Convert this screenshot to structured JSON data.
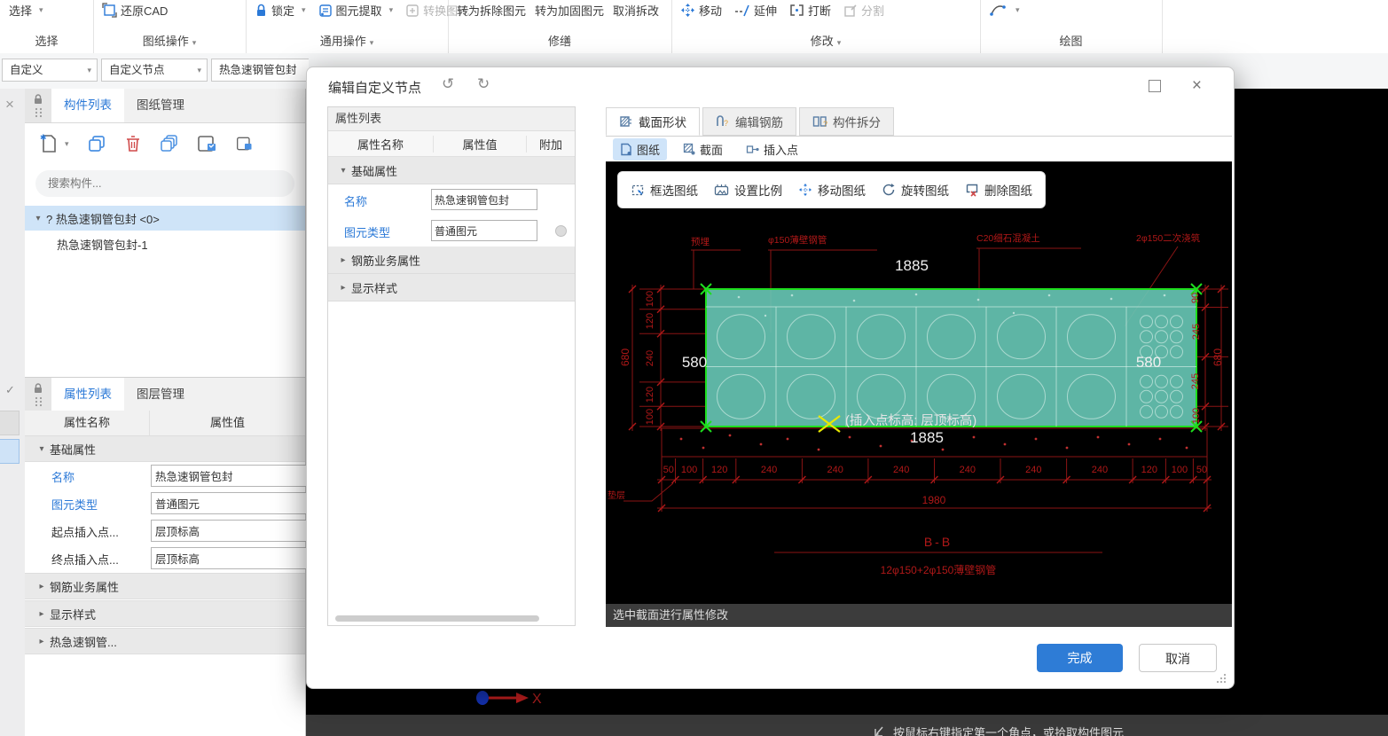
{
  "icons": {
    "caret": "▾",
    "close": "×",
    "undo": "↺",
    "redo": "↻",
    "check": "✓",
    "expander_open": "▾",
    "expander_closed": "▸",
    "tree_expander": "▾"
  },
  "ribbon": {
    "groups": [
      {
        "label": "选择",
        "items": [
          "选择"
        ]
      },
      {
        "label": "图纸操作",
        "items": [
          "还原CAD"
        ]
      },
      {
        "label": "通用操作",
        "items": [
          "锁定",
          "图元提取",
          "转换图元"
        ]
      },
      {
        "label": "修缮",
        "items": [
          "转为拆除图元",
          "转为加固图元",
          "取消拆改"
        ]
      },
      {
        "label": "修改",
        "items": [
          "移动",
          "延伸",
          "打断",
          "分割"
        ]
      },
      {
        "label": "绘图",
        "items": []
      }
    ]
  },
  "combos": [
    "自定义",
    "自定义节点",
    "热急速钢管包封"
  ],
  "components_panel": {
    "tabs": [
      "构件列表",
      "图纸管理"
    ],
    "search_placeholder": "搜索构件...",
    "tree": [
      {
        "label": "? 热急速钢管包封 <0>"
      },
      {
        "label": "热急速钢管包封-1"
      }
    ]
  },
  "props_panel": {
    "tabs": [
      "属性列表",
      "图层管理"
    ],
    "columns": [
      "属性名称",
      "属性值"
    ],
    "rows": [
      {
        "name": "基础属性"
      },
      {
        "name": "名称",
        "value": "热急速钢管包封"
      },
      {
        "name": "图元类型",
        "value": "普通图元"
      },
      {
        "name": "起点插入点...",
        "value": "层顶标高"
      },
      {
        "name": "终点插入点...",
        "value": "层顶标高"
      },
      {
        "name": "钢筋业务属性"
      },
      {
        "name": "显示样式"
      },
      {
        "name": "热急速钢管..."
      }
    ]
  },
  "dialog": {
    "title": "编辑自定义节点",
    "tabs": [
      "截面形状",
      "编辑钢筋",
      "构件拆分"
    ],
    "view_tools": [
      "图纸",
      "截面",
      "插入点"
    ],
    "canvas_tools": [
      "框选图纸",
      "设置比例",
      "移动图纸",
      "旋转图纸",
      "删除图纸"
    ],
    "props": {
      "header": "属性列表",
      "columns": [
        "属性名称",
        "属性值",
        "附加"
      ],
      "rows": [
        {
          "name": "基础属性"
        },
        {
          "name": "名称",
          "value": "热急速钢管包封"
        },
        {
          "name": "图元类型",
          "value": "普通图元"
        },
        {
          "name": "钢筋业务属性"
        },
        {
          "name": "显示样式"
        }
      ]
    },
    "status": "选中截面进行属性修改",
    "ok": "完成",
    "cancel": "取消"
  },
  "drawing": {
    "dims": {
      "top": "1885",
      "bottom": "1885",
      "left": "580",
      "right": "580",
      "overall_bottom": "1980",
      "overall_left": "680",
      "overall_right": "680"
    },
    "left_chain": [
      "100",
      "120",
      "240",
      "120",
      "100"
    ],
    "right_chain": [
      "90",
      "245",
      "245",
      "100"
    ],
    "bottom_chain": [
      "50",
      "100",
      "120",
      "240",
      "240",
      "240",
      "240",
      "240",
      "240",
      "120",
      "100",
      "50"
    ],
    "annotations": [
      "预埋",
      "φ150薄壁钢管",
      "C20细石混凝土",
      "2φ150二次浇筑",
      "垫层"
    ],
    "insert_note": "(插入点标高: 层顶标高)",
    "section_title": "B-B",
    "rebar_note": "12φ150+2φ150薄壁钢管",
    "axis_label": "X"
  },
  "statusbar": {
    "hint": "按鼠标右键指定第一个角点，或拾取构件图元"
  },
  "colors": {
    "accent": "#2b79d7",
    "primary_button": "#2e7cd6",
    "selection_fill": "#66c4b3",
    "selection_border": "#1ede1e",
    "cad_red": "#8b1414",
    "canvas_bg": "#000000"
  }
}
